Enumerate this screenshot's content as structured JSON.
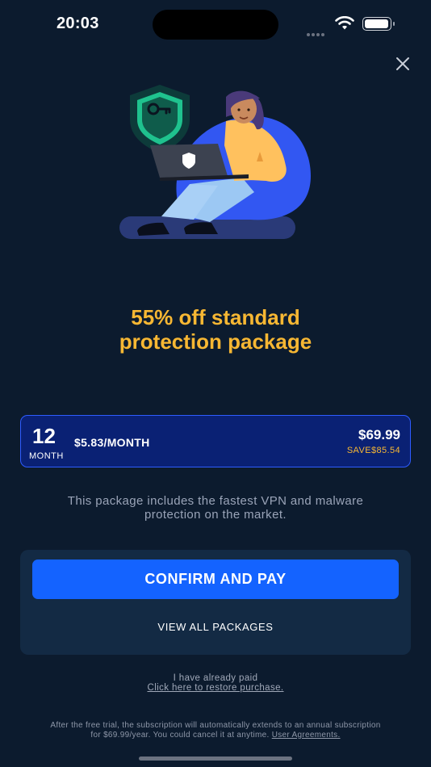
{
  "status_bar": {
    "time": "20:03",
    "icons": [
      "cellular-dots-icon",
      "wifi-icon",
      "battery-icon"
    ]
  },
  "close": {
    "icon": "close-icon"
  },
  "hero": {
    "illustration": "woman-with-laptop-and-vpn-shield",
    "shield_icon": "key-shield-icon"
  },
  "headline": {
    "line1": "55% off standard",
    "line2": "protection package",
    "color": "#f7b733"
  },
  "plan": {
    "months": "12",
    "months_unit": "MONTH",
    "monthly_price": "$5.83/MONTH",
    "total_price": "$69.99",
    "savings": "SAVE$85.54"
  },
  "description": {
    "line1": "This package includes the fastest VPN and malware",
    "line2": "protection on the market."
  },
  "actions": {
    "confirm_label": "CONFIRM AND PAY",
    "view_all_label": "VIEW ALL PACKAGES"
  },
  "restore": {
    "already_paid": "I have already paid",
    "link": "Click here to restore purchase."
  },
  "legal": {
    "line1": "After the free trial, the subscription will automatically extends to an annual subscription",
    "line2_prefix": "for $69.99/year. You could cancel it at anytime.",
    "link": "User Agreements."
  },
  "colors": {
    "background": "#0c1b2e",
    "accent_blue": "#1463ff",
    "plan_card": "#0a2174",
    "highlight": "#f7b733"
  }
}
